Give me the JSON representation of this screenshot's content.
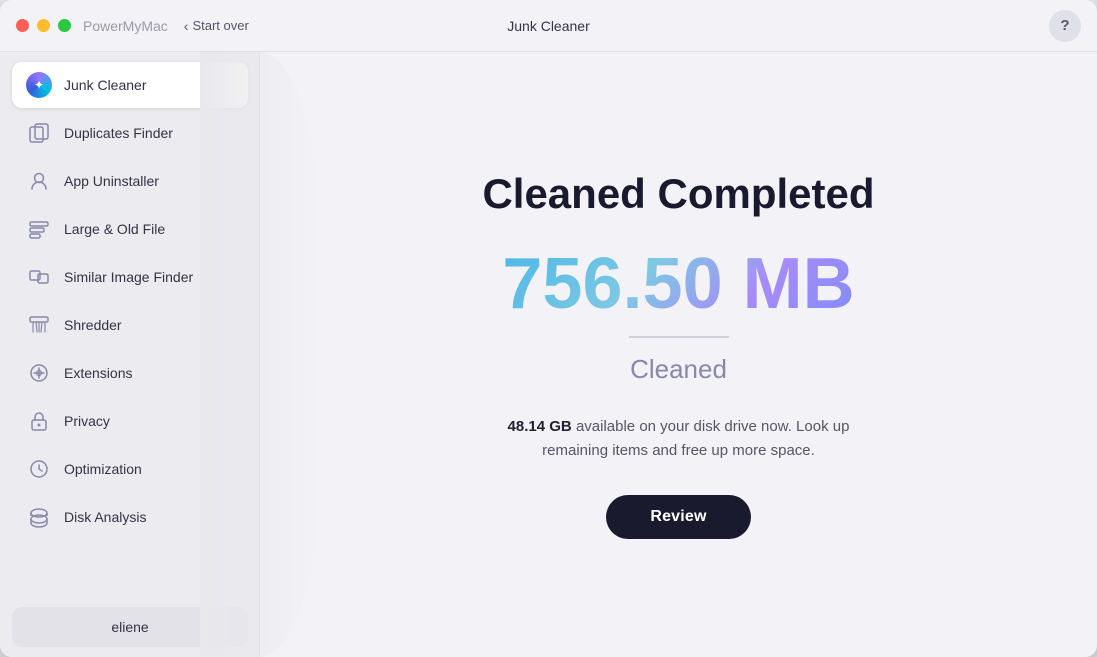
{
  "window": {
    "title": "Junk Cleaner",
    "app_name": "PowerMyMac",
    "start_over_label": "Start over",
    "help_label": "?"
  },
  "sidebar": {
    "items": [
      {
        "id": "junk-cleaner",
        "label": "Junk Cleaner",
        "icon": "junk",
        "active": true
      },
      {
        "id": "duplicates-finder",
        "label": "Duplicates Finder",
        "icon": "duplicates",
        "active": false
      },
      {
        "id": "app-uninstaller",
        "label": "App Uninstaller",
        "icon": "app",
        "active": false
      },
      {
        "id": "large-old-file",
        "label": "Large & Old File",
        "icon": "large",
        "active": false
      },
      {
        "id": "similar-image-finder",
        "label": "Similar Image Finder",
        "icon": "image",
        "active": false
      },
      {
        "id": "shredder",
        "label": "Shredder",
        "icon": "shredder",
        "active": false
      },
      {
        "id": "extensions",
        "label": "Extensions",
        "icon": "extensions",
        "active": false
      },
      {
        "id": "privacy",
        "label": "Privacy",
        "icon": "privacy",
        "active": false
      },
      {
        "id": "optimization",
        "label": "Optimization",
        "icon": "optimization",
        "active": false
      },
      {
        "id": "disk-analysis",
        "label": "Disk Analysis",
        "icon": "disk",
        "active": false
      }
    ],
    "user": {
      "name": "eliene"
    }
  },
  "content": {
    "heading": "Cleaned Completed",
    "amount": "756.50 MB",
    "cleaned_label": "Cleaned",
    "disk_available": "48.14 GB",
    "disk_info_text": "available on your disk drive now. Look up remaining items and free up more space.",
    "review_button": "Review"
  },
  "icons": {
    "duplicates": "⧉",
    "app": "⊞",
    "large": "🗂",
    "image": "⬜",
    "shredder": "▤",
    "extensions": "⚙",
    "privacy": "🔒",
    "optimization": "◈",
    "disk": "▭"
  }
}
